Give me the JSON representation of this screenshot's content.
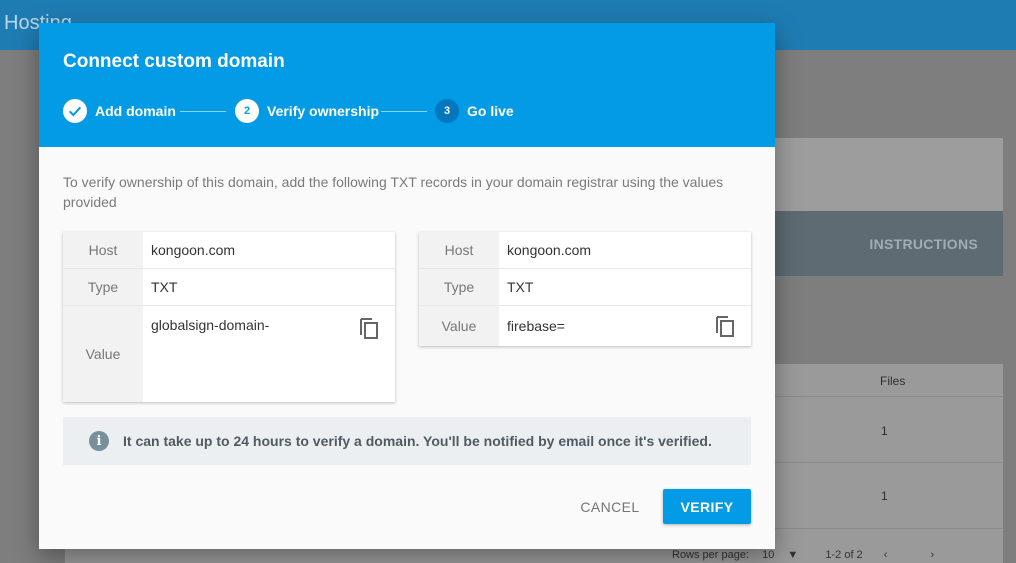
{
  "background": {
    "app_title": "Hosting",
    "instructions_label": "INSTRUCTIONS",
    "table": {
      "files_header": "Files",
      "rows": [
        {
          "files": "1"
        },
        {
          "files": "1"
        }
      ]
    },
    "footer": {
      "rows_per_page_label": "Rows per page:",
      "rows_per_page_value": "10",
      "page_range": "1-2 of 2"
    }
  },
  "dialog": {
    "title": "Connect custom domain",
    "steps": [
      {
        "number": "",
        "label": "Add domain",
        "state": "completed",
        "icon": "check-icon"
      },
      {
        "number": "2",
        "label": "Verify ownership",
        "state": "active"
      },
      {
        "number": "3",
        "label": "Go live",
        "state": "pending"
      }
    ],
    "description": "To verify ownership of this domain, add the following TXT records in your domain registrar using the values provided",
    "records": [
      {
        "host_label": "Host",
        "host": "kongoon.com",
        "type_label": "Type",
        "type": "TXT",
        "value_label": "Value",
        "value": "globalsign-domain-"
      },
      {
        "host_label": "Host",
        "host": "kongoon.com",
        "type_label": "Type",
        "type": "TXT",
        "value_label": "Value",
        "value": "firebase="
      }
    ],
    "info_message": "It can take up to 24 hours to verify a domain. You'll be notified by email once it's verified.",
    "cancel_label": "CANCEL",
    "verify_label": "VERIFY",
    "colors": {
      "header": "#039be5",
      "primary_button": "#039be5",
      "info_background": "#eceff1"
    }
  }
}
